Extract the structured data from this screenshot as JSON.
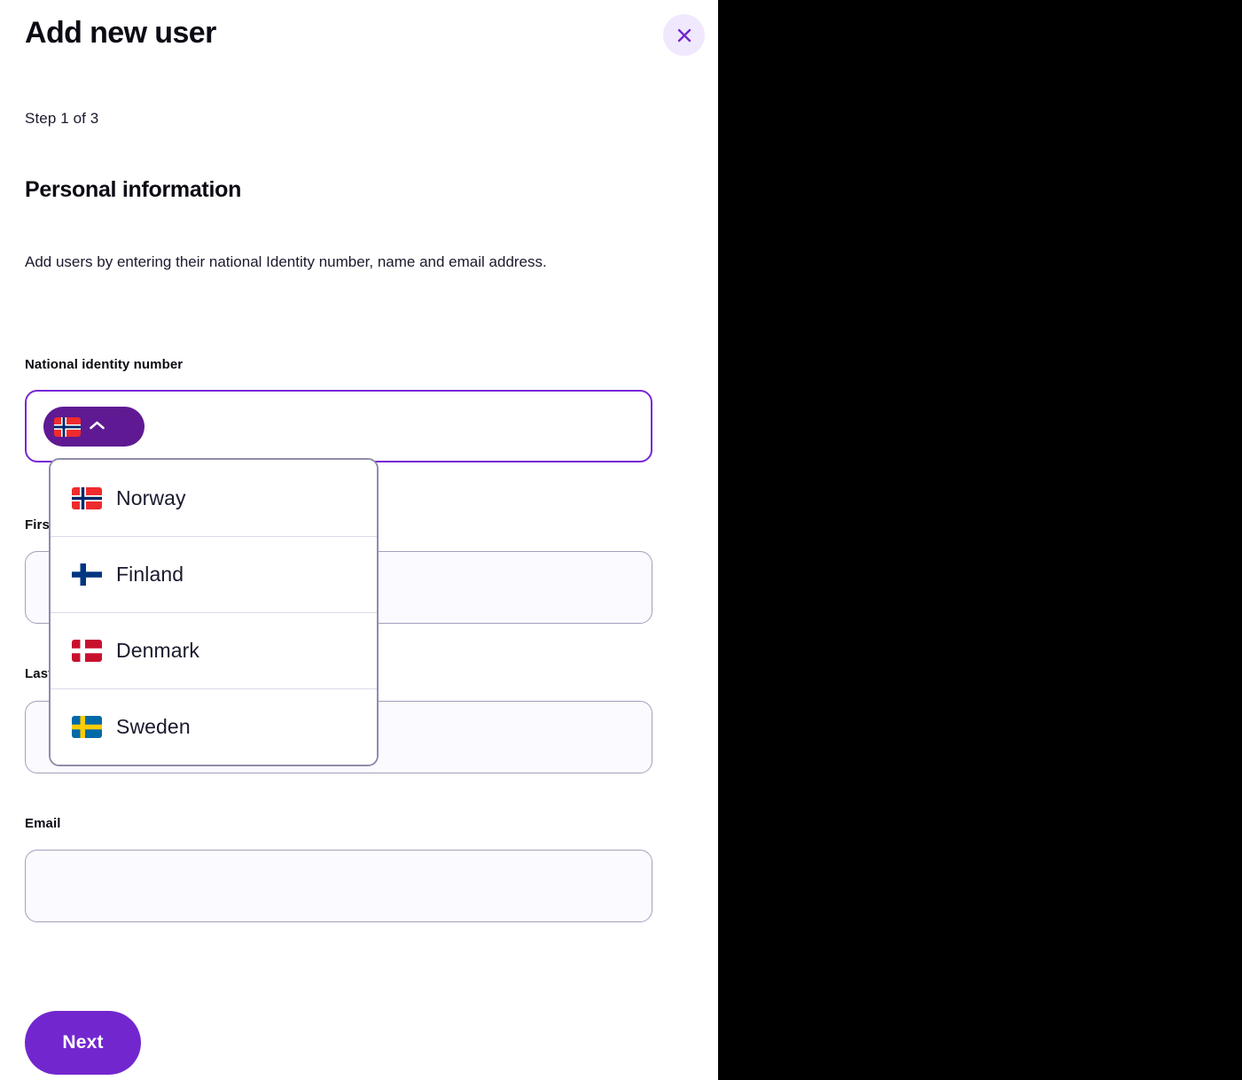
{
  "modal": {
    "title": "Add new user",
    "close_icon": "close-icon",
    "step_text": "Step 1 of 3",
    "section_title": "Personal information",
    "section_description": "Add users by entering their national Identity number, name and email address."
  },
  "form": {
    "fields": [
      {
        "label": "National identity number",
        "value": "",
        "placeholder": "",
        "focused": true
      },
      {
        "label": "First name",
        "value": "",
        "placeholder": "",
        "focused": false
      },
      {
        "label": "Last name",
        "value": "",
        "placeholder": "",
        "focused": false
      },
      {
        "label": "Email",
        "value": "",
        "placeholder": "",
        "focused": false
      }
    ],
    "country_selector": {
      "selected": "Norway",
      "selected_flag": "flag-norway-icon",
      "chevron_icon": "chevron-up-icon",
      "expanded": true,
      "options": [
        {
          "label": "Norway",
          "flag": "flag-norway-icon"
        },
        {
          "label": "Finland",
          "flag": "flag-finland-icon"
        },
        {
          "label": "Denmark",
          "flag": "flag-denmark-icon"
        },
        {
          "label": "Sweden",
          "flag": "flag-sweden-icon"
        }
      ]
    }
  },
  "footer": {
    "next_label": "Next"
  },
  "colors": {
    "accent_purple": "#7227ce",
    "pill_purple": "#5f1a93",
    "focus_border": "#7827d6",
    "close_bg": "#f0e9fd",
    "input_bg": "#fafaff",
    "input_border": "#a3a0bb",
    "dropdown_border": "#8f8cab",
    "text_dark": "#0b0b14",
    "backdrop": "#000000"
  }
}
